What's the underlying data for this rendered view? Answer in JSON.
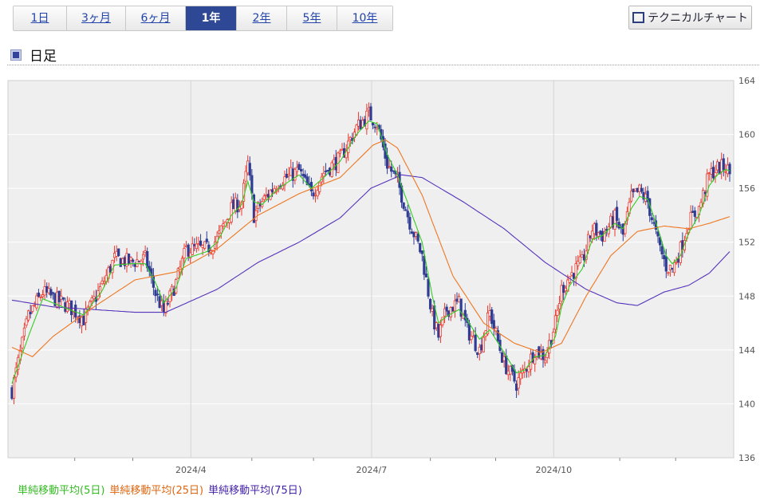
{
  "period_tabs": [
    {
      "label": "1日",
      "active": false
    },
    {
      "label": "3ヶ月",
      "active": false
    },
    {
      "label": "6ヶ月",
      "active": false
    },
    {
      "label": "1年",
      "active": true
    },
    {
      "label": "2年",
      "active": false
    },
    {
      "label": "5年",
      "active": false
    },
    {
      "label": "10年",
      "active": false
    }
  ],
  "technical_chart_button": "テクニカルチャート",
  "section_title": "日足",
  "colors": {
    "up_candle": "#e8392e",
    "down_candle": "#2f3c94",
    "ma5": "#33cc22",
    "ma25": "#ee7722",
    "ma75": "#5533bb",
    "plot_bg": "#efefef",
    "active_tab": "#2f4895"
  },
  "chart_data": {
    "type": "candlestick",
    "y_ticks": [
      "164",
      "160",
      "156",
      "152",
      "148",
      "144",
      "140",
      "136"
    ],
    "ylim": [
      136,
      164
    ],
    "x_labels": [
      "2024/4",
      "2024/7",
      "2024/10"
    ],
    "grid": true,
    "series": [
      {
        "name": "単純移動平均(5日)",
        "color": "#33cc22"
      },
      {
        "name": "単純移動平均(25日)",
        "color": "#ee7722"
      },
      {
        "name": "単純移動平均(75日)",
        "color": "#5533bb"
      }
    ],
    "close_path": [
      [
        0,
        141.0
      ],
      [
        8,
        146.5
      ],
      [
        15,
        148.3
      ],
      [
        28,
        147.2
      ],
      [
        35,
        146.3
      ],
      [
        44,
        148.8
      ],
      [
        50,
        150.8
      ],
      [
        58,
        150.5
      ],
      [
        65,
        150.8
      ],
      [
        70,
        148.2
      ],
      [
        74,
        146.8
      ],
      [
        80,
        149.0
      ],
      [
        85,
        151.5
      ],
      [
        95,
        151.5
      ],
      [
        100,
        152.2
      ],
      [
        107,
        154.5
      ],
      [
        112,
        155.0
      ],
      [
        115,
        157.8
      ],
      [
        118,
        154.0
      ],
      [
        122,
        155.0
      ],
      [
        130,
        156.5
      ],
      [
        140,
        157.3
      ],
      [
        146,
        155.5
      ],
      [
        152,
        157.2
      ],
      [
        160,
        158.2
      ],
      [
        168,
        160.5
      ],
      [
        174,
        161.5
      ],
      [
        178,
        160.8
      ],
      [
        183,
        157.8
      ],
      [
        188,
        156.5
      ],
      [
        194,
        153.5
      ],
      [
        200,
        151.0
      ],
      [
        205,
        146.5
      ],
      [
        208,
        145.0
      ],
      [
        212,
        147.0
      ],
      [
        218,
        147.5
      ],
      [
        222,
        145.5
      ],
      [
        228,
        144.0
      ],
      [
        233,
        146.8
      ],
      [
        240,
        143.0
      ],
      [
        246,
        141.5
      ],
      [
        250,
        142.5
      ],
      [
        255,
        144.0
      ],
      [
        260,
        143.5
      ],
      [
        265,
        146.0
      ],
      [
        268,
        148.5
      ],
      [
        272,
        149.5
      ],
      [
        278,
        150.5
      ],
      [
        283,
        153.0
      ],
      [
        288,
        152.5
      ],
      [
        294,
        153.8
      ],
      [
        298,
        152.5
      ],
      [
        302,
        155.3
      ],
      [
        306,
        155.8
      ],
      [
        310,
        155.0
      ],
      [
        315,
        152.0
      ],
      [
        319,
        150.2
      ],
      [
        322,
        150.0
      ],
      [
        326,
        151.5
      ],
      [
        330,
        153.5
      ],
      [
        335,
        154.5
      ],
      [
        340,
        157.0
      ],
      [
        344,
        157.5
      ],
      [
        348,
        157.6
      ],
      [
        350,
        157.1
      ]
    ],
    "ma5_path": [
      [
        0,
        141.5
      ],
      [
        8,
        145.0
      ],
      [
        15,
        147.8
      ],
      [
        28,
        147.0
      ],
      [
        35,
        146.6
      ],
      [
        44,
        148.4
      ],
      [
        50,
        150.3
      ],
      [
        58,
        150.4
      ],
      [
        65,
        150.4
      ],
      [
        70,
        149.0
      ],
      [
        74,
        147.5
      ],
      [
        80,
        148.6
      ],
      [
        85,
        150.8
      ],
      [
        95,
        151.3
      ],
      [
        100,
        152.0
      ],
      [
        107,
        154.0
      ],
      [
        112,
        154.8
      ],
      [
        115,
        156.5
      ],
      [
        118,
        155.0
      ],
      [
        122,
        154.8
      ],
      [
        130,
        156.0
      ],
      [
        140,
        157.0
      ],
      [
        146,
        156.0
      ],
      [
        152,
        156.8
      ],
      [
        160,
        158.0
      ],
      [
        168,
        160.0
      ],
      [
        174,
        161.0
      ],
      [
        178,
        160.8
      ],
      [
        183,
        158.5
      ],
      [
        188,
        157.0
      ],
      [
        194,
        154.5
      ],
      [
        200,
        152.0
      ],
      [
        205,
        148.0
      ],
      [
        208,
        146.0
      ],
      [
        212,
        146.5
      ],
      [
        218,
        147.0
      ],
      [
        222,
        146.2
      ],
      [
        228,
        144.8
      ],
      [
        233,
        145.5
      ],
      [
        240,
        143.8
      ],
      [
        246,
        142.3
      ],
      [
        250,
        142.5
      ],
      [
        255,
        143.5
      ],
      [
        260,
        143.6
      ],
      [
        265,
        145.0
      ],
      [
        268,
        147.2
      ],
      [
        272,
        148.8
      ],
      [
        278,
        150.0
      ],
      [
        283,
        152.2
      ],
      [
        288,
        152.5
      ],
      [
        294,
        153.4
      ],
      [
        298,
        153.0
      ],
      [
        302,
        154.5
      ],
      [
        306,
        155.4
      ],
      [
        310,
        155.2
      ],
      [
        315,
        153.0
      ],
      [
        319,
        151.0
      ],
      [
        322,
        150.4
      ],
      [
        326,
        151.0
      ],
      [
        330,
        152.7
      ],
      [
        335,
        154.0
      ],
      [
        340,
        156.2
      ],
      [
        344,
        157.0
      ],
      [
        348,
        157.4
      ],
      [
        350,
        157.3
      ]
    ],
    "ma25_path": [
      [
        0,
        144.2
      ],
      [
        10,
        143.5
      ],
      [
        20,
        145.0
      ],
      [
        40,
        147.2
      ],
      [
        60,
        149.2
      ],
      [
        80,
        149.8
      ],
      [
        100,
        151.5
      ],
      [
        120,
        154.0
      ],
      [
        140,
        155.6
      ],
      [
        160,
        156.8
      ],
      [
        176,
        159.2
      ],
      [
        182,
        159.6
      ],
      [
        188,
        159.0
      ],
      [
        200,
        155.5
      ],
      [
        215,
        149.5
      ],
      [
        230,
        146.0
      ],
      [
        245,
        144.5
      ],
      [
        258,
        143.8
      ],
      [
        268,
        144.5
      ],
      [
        280,
        148.0
      ],
      [
        292,
        151.0
      ],
      [
        305,
        152.8
      ],
      [
        318,
        153.2
      ],
      [
        330,
        153.0
      ],
      [
        340,
        153.4
      ],
      [
        350,
        153.9
      ]
    ],
    "ma75_path": [
      [
        0,
        147.7
      ],
      [
        20,
        147.2
      ],
      [
        40,
        147.0
      ],
      [
        60,
        146.8
      ],
      [
        75,
        146.8
      ],
      [
        100,
        148.5
      ],
      [
        120,
        150.5
      ],
      [
        140,
        152.0
      ],
      [
        160,
        153.8
      ],
      [
        175,
        156.0
      ],
      [
        190,
        157.0
      ],
      [
        200,
        156.8
      ],
      [
        220,
        155.0
      ],
      [
        240,
        153.0
      ],
      [
        260,
        150.5
      ],
      [
        280,
        148.5
      ],
      [
        295,
        147.5
      ],
      [
        305,
        147.3
      ],
      [
        318,
        148.3
      ],
      [
        330,
        148.8
      ],
      [
        340,
        149.7
      ],
      [
        350,
        151.3
      ]
    ]
  }
}
